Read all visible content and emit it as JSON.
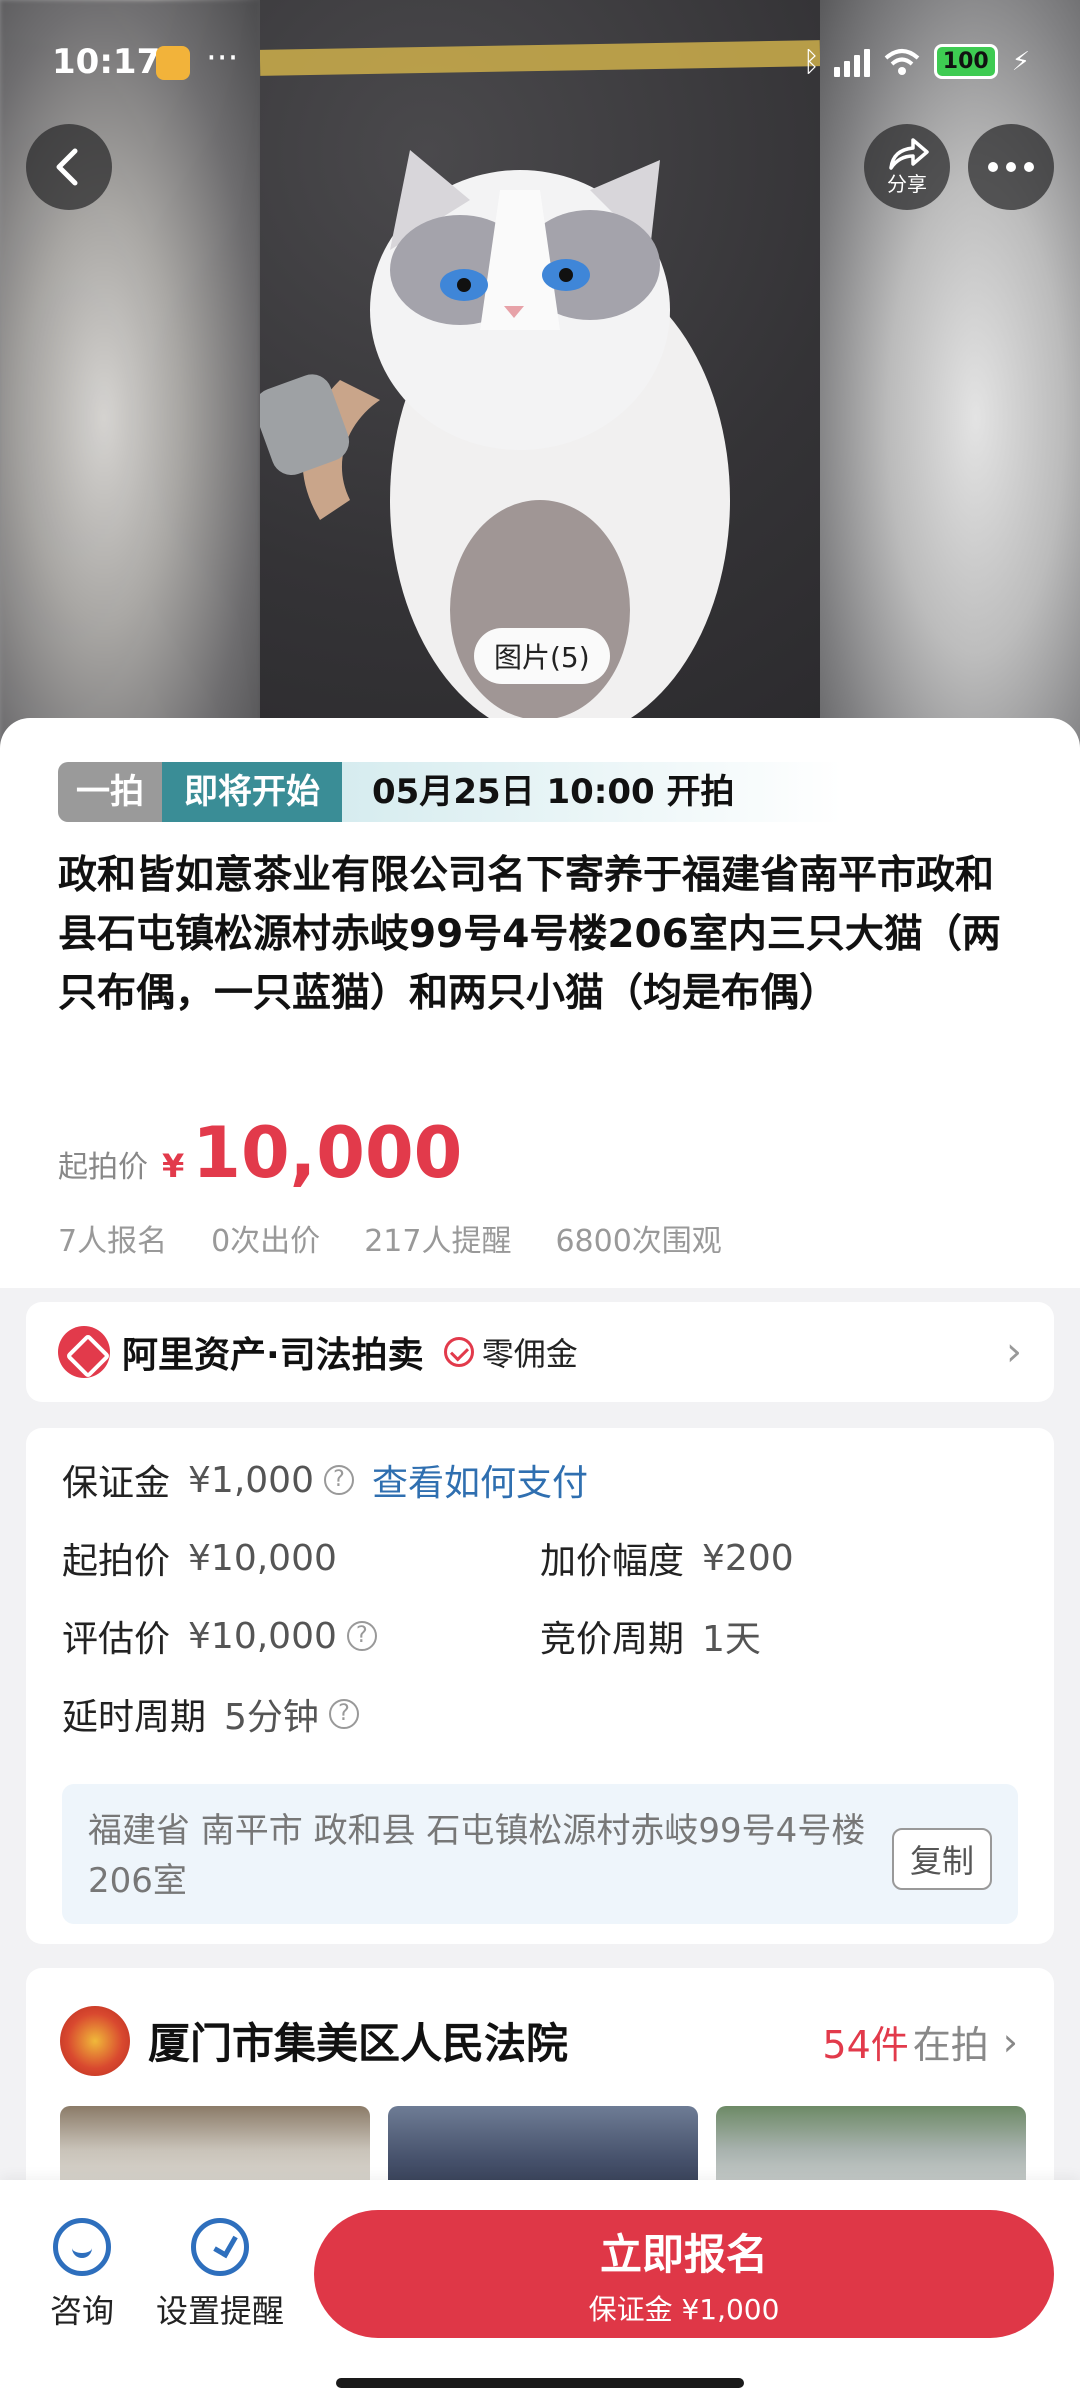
{
  "status_bar": {
    "time": "10:17",
    "dots": "···",
    "battery": "100"
  },
  "nav": {
    "share_label": "分享"
  },
  "gallery": {
    "count_label": "图片(5)"
  },
  "auction": {
    "tag_type": "一拍",
    "tag_status": "即将开始",
    "start_time": "05月25日 10:00 开拍",
    "title": "政和皆如意茶业有限公司名下寄养于福建省南平市政和县石屯镇松源村赤岐99号4号楼206室内三只大猫（两只布偶，一只蓝猫）和两只小猫（均是布偶）",
    "price_label": "起拍价",
    "currency": "¥",
    "price": "10,000",
    "stats": {
      "signups": "7人报名",
      "bids": "0次出价",
      "reminders": "217人提醒",
      "views": "6800次围观"
    }
  },
  "platform": {
    "name": "阿里资产·司法拍卖",
    "badge": "零佣金"
  },
  "details": {
    "deposit_label": "保证金",
    "deposit_value": "¥1,000",
    "deposit_link": "查看如何支付",
    "start_label": "起拍价",
    "start_value": "¥10,000",
    "increment_label": "加价幅度",
    "increment_value": "¥200",
    "appraisal_label": "评估价",
    "appraisal_value": "¥10,000",
    "cycle_label": "竞价周期",
    "cycle_value": "1天",
    "delay_label": "延时周期",
    "delay_value": "5分钟",
    "address": "福建省 南平市 政和县 石屯镇松源村赤岐99号4号楼206室",
    "copy_label": "复制"
  },
  "court": {
    "name": "厦门市集美区人民法院",
    "count": "54件",
    "count_label": "在拍"
  },
  "bottom_bar": {
    "consult_label": "咨询",
    "remind_label": "设置提醒",
    "signup_title": "立即报名",
    "signup_sub": "保证金 ¥1,000"
  },
  "colors": {
    "accent_red": "#df3747",
    "teal": "#3a8d96",
    "link_blue": "#2f6fb0"
  }
}
